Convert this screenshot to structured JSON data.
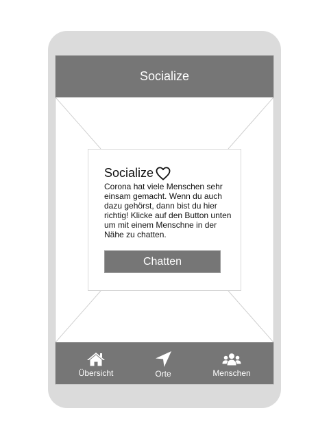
{
  "header": {
    "title": "Socialize"
  },
  "card": {
    "title": "Socialize",
    "title_icon": "heart-outline-icon",
    "text": "Corona hat viele Menschen sehr einsam gemacht. Wenn du auch dazu gehörst, dann bist du hier richtig! Klicke auf den Button unten um mit einem Menschne in der Nähe zu chatten.",
    "button_label": "Chatten"
  },
  "tabbar": {
    "items": [
      {
        "label": "Übersicht",
        "icon": "home-icon"
      },
      {
        "label": "Orte",
        "icon": "location-arrow-icon"
      },
      {
        "label": "Menschen",
        "icon": "users-icon"
      }
    ]
  },
  "colors": {
    "bar": "#767676",
    "device_frame": "#dbdbdb",
    "text": "#111111"
  }
}
